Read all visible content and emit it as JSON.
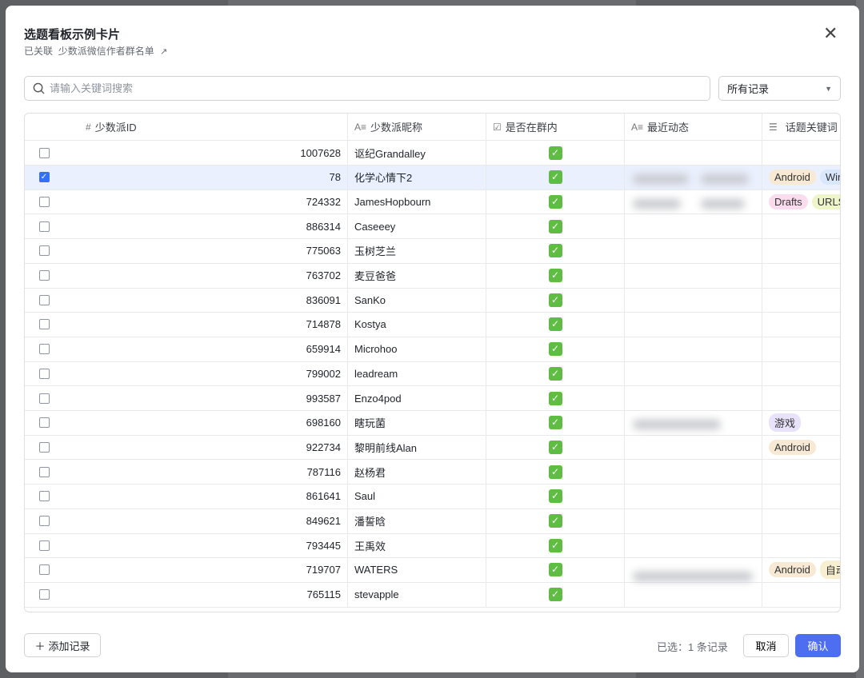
{
  "dialog": {
    "title": "选题看板示例卡片",
    "linked_label": "已关联",
    "linked_table": "少数派微信作者群名单",
    "close": "✕"
  },
  "search": {
    "placeholder": "请输入关键词搜索"
  },
  "filter": {
    "selected": "所有记录"
  },
  "columns": [
    {
      "icon": "#",
      "label": "少数派ID"
    },
    {
      "icon": "A≡",
      "label": "少数派昵称"
    },
    {
      "icon": "☑",
      "label": "是否在群内"
    },
    {
      "icon": "A≡",
      "label": "最近动态"
    },
    {
      "icon": "☰",
      "label": "话题关键词"
    }
  ],
  "rows": [
    {
      "id": "1007628",
      "name": "讴纪Grandalley",
      "selected": false,
      "in_group": true,
      "tags": []
    },
    {
      "id": "78",
      "name": "化学心情下2",
      "selected": true,
      "in_group": true,
      "tags": [
        "Android",
        "Win"
      ]
    },
    {
      "id": "724332",
      "name": "JamesHopbourn",
      "selected": false,
      "in_group": true,
      "tags": [
        "Drafts",
        "URLS"
      ]
    },
    {
      "id": "886314",
      "name": "Caseeey",
      "selected": false,
      "in_group": true,
      "tags": []
    },
    {
      "id": "775063",
      "name": "玉树芝兰",
      "selected": false,
      "in_group": true,
      "tags": []
    },
    {
      "id": "763702",
      "name": "麦豆爸爸",
      "selected": false,
      "in_group": true,
      "tags": []
    },
    {
      "id": "836091",
      "name": "SanKo",
      "selected": false,
      "in_group": true,
      "tags": []
    },
    {
      "id": "714878",
      "name": "Kostya",
      "selected": false,
      "in_group": true,
      "tags": []
    },
    {
      "id": "659914",
      "name": "Microhoo",
      "selected": false,
      "in_group": true,
      "tags": []
    },
    {
      "id": "799002",
      "name": "leadream",
      "selected": false,
      "in_group": true,
      "tags": []
    },
    {
      "id": "993587",
      "name": "Enzo4pod",
      "selected": false,
      "in_group": true,
      "tags": []
    },
    {
      "id": "698160",
      "name": "瞎玩菌",
      "selected": false,
      "in_group": true,
      "tags": [
        "游戏"
      ]
    },
    {
      "id": "922734",
      "name": "黎明前线Alan",
      "selected": false,
      "in_group": true,
      "tags": [
        "Android"
      ]
    },
    {
      "id": "787116",
      "name": "赵杨君",
      "selected": false,
      "in_group": true,
      "tags": []
    },
    {
      "id": "861641",
      "name": "Saul",
      "selected": false,
      "in_group": true,
      "tags": []
    },
    {
      "id": "849621",
      "name": "潘誓晗",
      "selected": false,
      "in_group": true,
      "tags": []
    },
    {
      "id": "793445",
      "name": "王禹效",
      "selected": false,
      "in_group": true,
      "tags": []
    },
    {
      "id": "719707",
      "name": "WATERS",
      "selected": false,
      "in_group": true,
      "tags": [
        "Android",
        "自动"
      ]
    },
    {
      "id": "765115",
      "name": "stevapple",
      "selected": false,
      "in_group": true,
      "tags": []
    }
  ],
  "tag_colors": {
    "Android": "#f7e9d4",
    "Win": "#d8e7fc",
    "Drafts": "#fbdcef",
    "URLS": "#eef5c9",
    "游戏": "#e8e2fb",
    "自动": "#f7efcf"
  },
  "footer": {
    "add_label": "添加记录",
    "selected_count": "已选：1 条记录",
    "cancel": "取消",
    "confirm": "确认"
  }
}
